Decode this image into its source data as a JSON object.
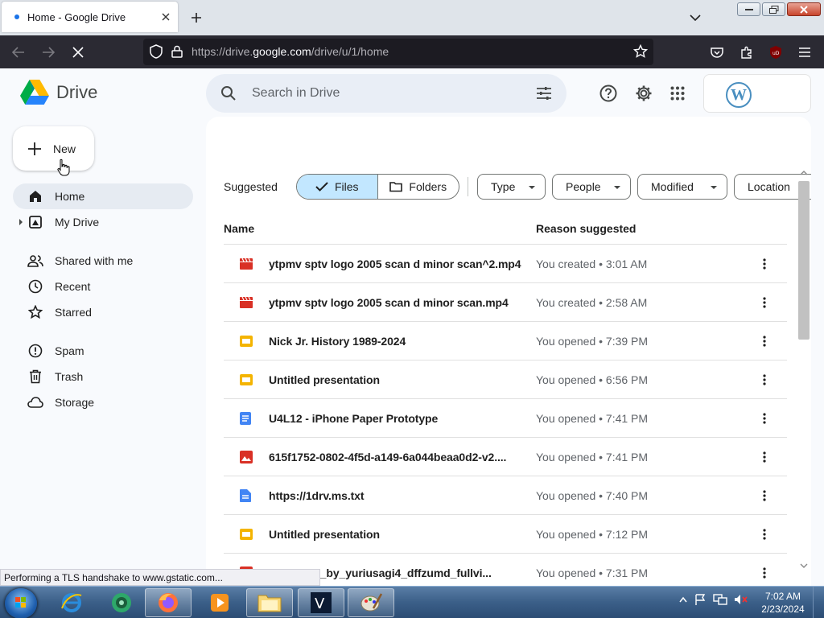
{
  "browser": {
    "tab_title": "Home - Google Drive",
    "url_prefix": "https://drive.",
    "url_domain": "google.com",
    "url_path": "/drive/u/1/home",
    "status_text": "Performing a TLS handshake to www.gstatic.com..."
  },
  "app": {
    "logo_text": "Drive",
    "search_placeholder": "Search in Drive",
    "account_logo_letter": "W"
  },
  "sidebar": {
    "new_label": "New",
    "items": [
      {
        "label": "Home",
        "icon": "home-icon",
        "active": true
      },
      {
        "label": "My Drive",
        "icon": "my-drive-icon"
      },
      {
        "label": "Shared with me",
        "icon": "shared-icon"
      },
      {
        "label": "Recent",
        "icon": "clock-icon"
      },
      {
        "label": "Starred",
        "icon": "star-icon"
      },
      {
        "label": "Spam",
        "icon": "spam-icon"
      },
      {
        "label": "Trash",
        "icon": "trash-icon"
      },
      {
        "label": "Storage",
        "icon": "cloud-icon"
      }
    ]
  },
  "filters": {
    "suggested_label": "Suggested",
    "files_label": "Files",
    "folders_label": "Folders",
    "chips": [
      "Type",
      "People",
      "Modified",
      "Location"
    ]
  },
  "table": {
    "col_name": "Name",
    "col_reason": "Reason suggested",
    "rows": [
      {
        "name": "ytpmv sptv logo 2005 scan d minor scan^2.mp4",
        "reason": "You created • 3:01 AM",
        "type": "video"
      },
      {
        "name": "ytpmv sptv logo 2005 scan d minor scan.mp4",
        "reason": "You created • 2:58 AM",
        "type": "video"
      },
      {
        "name": "Nick Jr. History 1989-2024",
        "reason": "You opened • 7:39 PM",
        "type": "slides"
      },
      {
        "name": "Untitled presentation",
        "reason": "You opened • 6:56 PM",
        "type": "slides"
      },
      {
        "name": "U4L12 - iPhone Paper Prototype",
        "reason": "You opened • 7:41 PM",
        "type": "doc"
      },
      {
        "name": "615f1752-0802-4f5d-a149-6a044beaa0d2-v2....",
        "reason": "You opened • 7:41 PM",
        "type": "image"
      },
      {
        "name": "https://1drv.ms.txt",
        "reason": "You opened • 7:40 PM",
        "type": "text"
      },
      {
        "name": "Untitled presentation",
        "reason": "You opened • 7:12 PM",
        "type": "slides"
      },
      {
        "name": "wallpaper_by_yuriusagi4_dffzumd_fullvi...",
        "reason": "You opened • 7:31 PM",
        "type": "image"
      }
    ]
  },
  "taskbar": {
    "time": "7:02 AM",
    "date": "2/23/2024"
  },
  "colors": {
    "accent": "#c2e7ff",
    "video": "#d93025",
    "slides": "#f4b400",
    "doc": "#4285f4"
  }
}
